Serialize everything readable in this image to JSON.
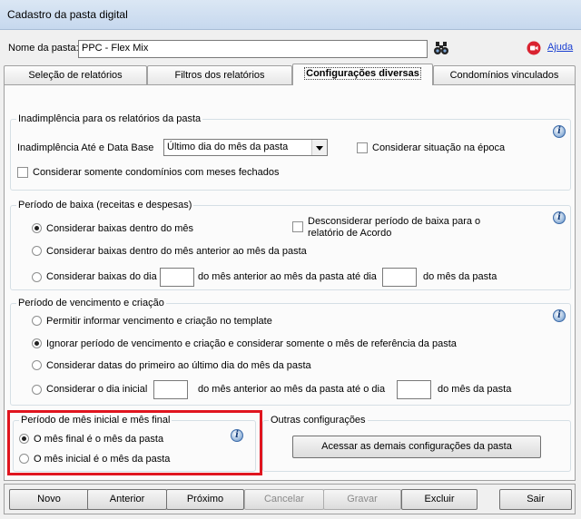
{
  "window": {
    "title": "Cadastro da pasta digital"
  },
  "folder": {
    "label": "Nome da pasta:",
    "value": "PPC - Flex Mix",
    "help_label": "Ajuda"
  },
  "tabs": [
    {
      "label": "Seleção de relatórios"
    },
    {
      "label": "Filtros dos relatórios"
    },
    {
      "label": "Configurações diversas"
    },
    {
      "label": "Condomínios vinculados"
    }
  ],
  "inadimplencia": {
    "legend": "Inadimplência para os relatórios da pasta",
    "date_label": "Inadimplência Até e Data Base",
    "date_value": "Último dia do mês da pasta",
    "check_epoca": "Considerar situação na época",
    "check_fechados": "Considerar somente condomínios com meses fechados"
  },
  "baixa": {
    "legend": "Período de baixa (receitas e despesas)",
    "opt1": "Considerar baixas dentro do mês",
    "opt2": "Considerar baixas dentro do mês anterior ao mês da pasta",
    "opt3_a": "Considerar baixas do dia",
    "opt3_b": "do mês anterior ao mês da pasta até dia",
    "opt3_c": "do mês da pasta",
    "check_acordo_1": "Desconsiderar período de baixa para o",
    "check_acordo_2": "relatório de Acordo"
  },
  "vencimento": {
    "legend": "Período de vencimento e criação",
    "opt1": "Permitir informar vencimento e criação no template",
    "opt2": "Ignorar período de vencimento e criação e considerar somente o mês de referência da pasta",
    "opt3": "Considerar datas do primeiro ao último dia do mês da pasta",
    "opt4_a": "Considerar o dia inicial",
    "opt4_b": "do mês anterior ao mês da pasta até o dia",
    "opt4_c": "do mês da pasta"
  },
  "mes": {
    "legend": "Período de mês inicial e mês final",
    "opt1": "O mês final é o mês da pasta",
    "opt2": "O mês inicial é o mês da pasta"
  },
  "outras": {
    "legend": "Outras configurações",
    "button": "Acessar as demais configurações da pasta"
  },
  "buttons": {
    "novo": "Novo",
    "anterior": "Anterior",
    "proximo": "Próximo",
    "cancelar": "Cancelar",
    "gravar": "Gravar",
    "excluir": "Excluir",
    "sair": "Sair"
  },
  "colors": {
    "highlight": "#e0151f",
    "help_link": "#1a3fd1"
  }
}
